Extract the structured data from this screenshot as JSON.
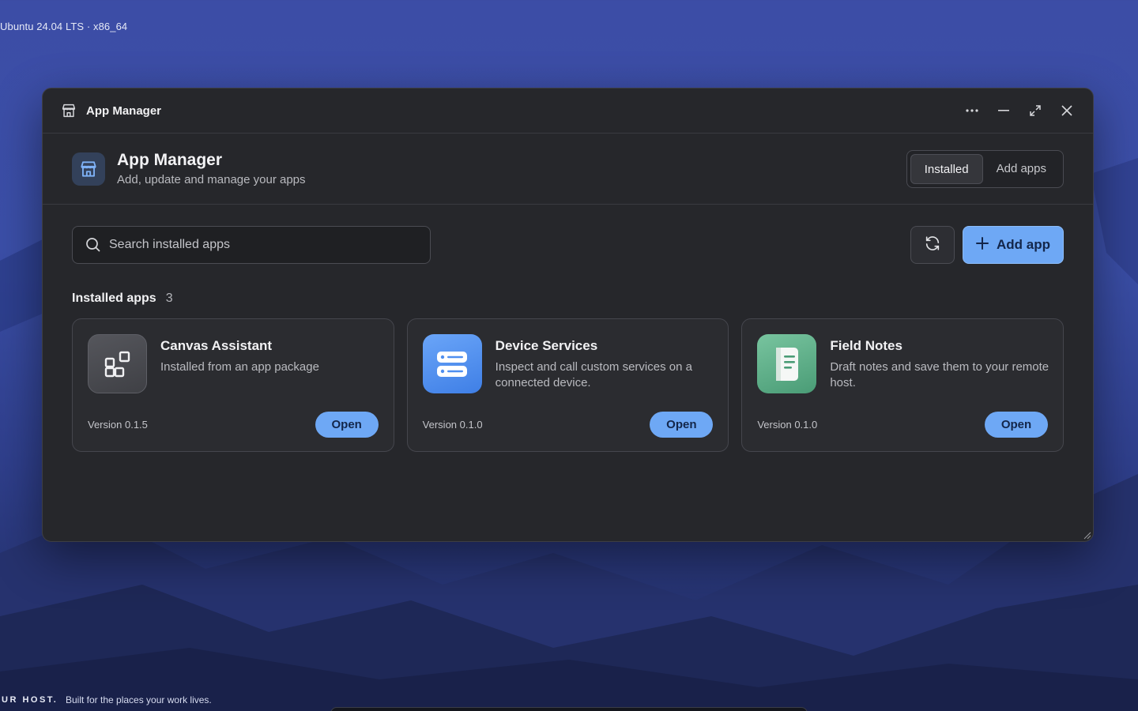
{
  "desktop": {
    "os_label": "Ubuntu 24.04 LTS · x86_64",
    "footer_brand": "UR HOST.",
    "footer_tagline": "Built for the places your work lives."
  },
  "window": {
    "title": "App Manager",
    "controls": [
      "more-icon",
      "minimize-icon",
      "maximize-icon",
      "close-icon"
    ]
  },
  "header": {
    "title": "App Manager",
    "subtitle": "Add, update and manage your apps",
    "tabs": [
      {
        "label": "Installed",
        "active": true
      },
      {
        "label": "Add apps",
        "active": false
      }
    ]
  },
  "toolbar": {
    "search_placeholder": "Search installed apps",
    "add_label": "Add app"
  },
  "section": {
    "title": "Installed apps",
    "count": "3"
  },
  "apps": [
    {
      "name": "Canvas Assistant",
      "description": "Installed from an app package",
      "version": "Version 0.1.5",
      "open_label": "Open",
      "icon": "widgets-icon",
      "icon_bg": "#4a4b50"
    },
    {
      "name": "Device Services",
      "description": "Inspect and call custom services on a connected device.",
      "version": "Version 0.1.0",
      "open_label": "Open",
      "icon": "server-icon",
      "icon_bg": "#4f8ff0"
    },
    {
      "name": "Field Notes",
      "description": "Draft notes and save them to your remote host.",
      "version": "Version 0.1.0",
      "open_label": "Open",
      "icon": "notes-icon",
      "icon_bg": "#5fb38c"
    }
  ],
  "colors": {
    "accent": "#6ea8f5",
    "window_bg": "#26272b",
    "card_bg": "#2b2c30"
  }
}
